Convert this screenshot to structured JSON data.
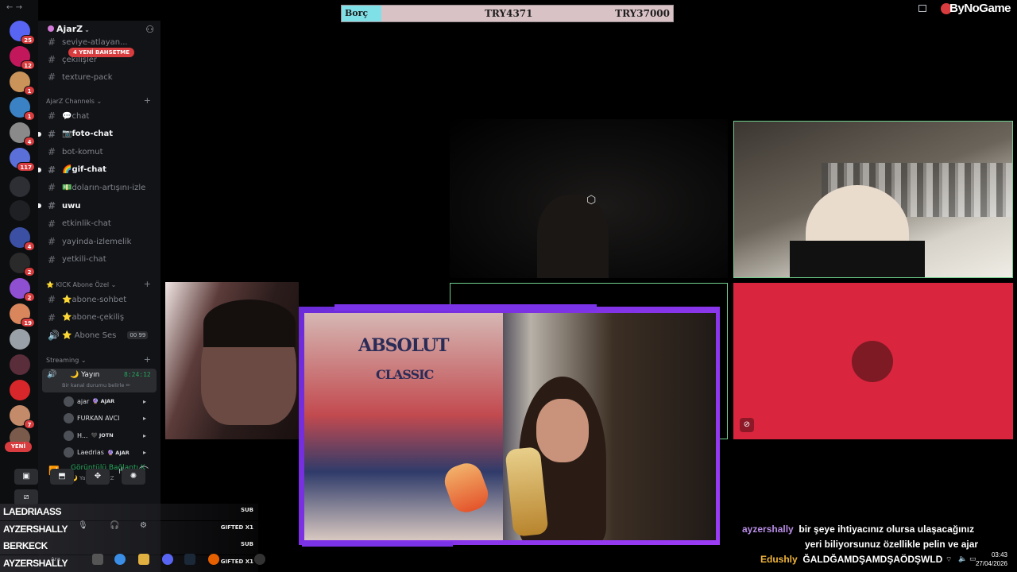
{
  "top_nav": {
    "back": "←",
    "forward": "→"
  },
  "rail": {
    "servers": [
      {
        "badge": "25",
        "color": "#5865f2"
      },
      {
        "badge": "12",
        "color": "#c2185b"
      },
      {
        "badge": "1",
        "color": "#c9935a"
      },
      {
        "badge": "1",
        "color": "#3b82c4"
      },
      {
        "badge": "4",
        "color": "#8a8a8a"
      },
      {
        "badge": "117",
        "color": "#5b6fd8"
      },
      {
        "badge": "",
        "color": "#2d2f35"
      },
      {
        "badge": "",
        "color": "#1f2023"
      },
      {
        "badge": "4",
        "color": "#3b4fa3"
      },
      {
        "badge": "2",
        "color": "#2a2a2a"
      },
      {
        "badge": "2",
        "color": "#8e4fd0"
      },
      {
        "badge": "19",
        "color": "#d9865c"
      },
      {
        "badge": "",
        "color": "#9aa0a8"
      },
      {
        "badge": "",
        "color": "#5a2d3a"
      },
      {
        "badge": "",
        "color": "#d8272a"
      },
      {
        "badge": "7",
        "color": "#c48b6a"
      },
      {
        "badge": "",
        "color": "#7a5a4a"
      }
    ],
    "new_pill": "YENİ"
  },
  "sidebar": {
    "server_name": "AjarZ",
    "mention_pill": "4 YENİ BAHSETME",
    "top_channels": [
      {
        "name": "seviye-atlayan...",
        "bold": false
      },
      {
        "name": "çekilişler",
        "bold": false
      },
      {
        "name": "texture-pack",
        "bold": false
      }
    ],
    "categories": [
      {
        "name": "AjarZ Channels",
        "channels": [
          {
            "name": "💬chat",
            "bold": false,
            "unread": false
          },
          {
            "name": "📷foto-chat",
            "bold": true,
            "unread": true
          },
          {
            "name": "bot-komut",
            "bold": false,
            "unread": false
          },
          {
            "name": "🌈gif-chat",
            "bold": true,
            "unread": true
          },
          {
            "name": "💵doların-artışını-izle",
            "bold": false,
            "unread": false
          },
          {
            "name": "uwu",
            "bold": true,
            "unread": true
          },
          {
            "name": "etkinlik-chat",
            "bold": false,
            "unread": false
          },
          {
            "name": "yayinda-izlemelik",
            "bold": false,
            "unread": false
          },
          {
            "name": "yetkili-chat",
            "bold": false,
            "unread": false
          }
        ]
      },
      {
        "name": "⭐ KICK Abone Özel",
        "channels": [
          {
            "name": "⭐abone-sohbet",
            "bold": false,
            "unread": false
          },
          {
            "name": "⭐abone-çekiliş",
            "bold": false,
            "unread": false
          },
          {
            "name": "⭐ Abone Ses",
            "bold": false,
            "unread": false,
            "counts": "00  99"
          }
        ]
      }
    ],
    "streaming": {
      "category": "Streaming",
      "channel": "🌙 Yayın",
      "elapsed": "8:24:12",
      "status": "Bir kanal durumu belirle ✏",
      "users": [
        {
          "name": "ajar",
          "tag": "🔮 AJAR"
        },
        {
          "name": "FURKAN AVCI",
          "tag": ""
        },
        {
          "name": "H...",
          "tag": "🖤 JOTN"
        },
        {
          "name": "Laedrias",
          "tag": "🔮 AJAR"
        }
      ]
    },
    "connection": {
      "title": "Görüntülü Bağlantı K",
      "subtitle": "🌙 Yayın / AjarZ"
    }
  },
  "subs": [
    {
      "name": "LAEDRIAASS",
      "tag": "SUB"
    },
    {
      "name": "AYZERSHALLY",
      "tag": "GIFTED X1"
    },
    {
      "name": "BERKECK",
      "tag": "SUB"
    },
    {
      "name": "AYZERSHALLY",
      "tag": "GIFTED X1"
    }
  ],
  "debt": {
    "label": "Borç",
    "current": "TRY4371",
    "target": "TRY37000"
  },
  "brand": "ByNoGame",
  "poster": {
    "line1": "ABSOLUT",
    "line2": "CLASSIC"
  },
  "chat": {
    "messages": [
      {
        "user": "ayzershally",
        "text": "bir şeye ihtiyacınız olursa ulaşacağınız"
      },
      {
        "user": "",
        "text": "yeri biliyorsunuz özellikle pelin ve ajar"
      },
      {
        "user": "Edushly",
        "text": "ĞALDĞAMDŞAMDŞAÖDŞWLD"
      }
    ]
  },
  "taskbar": {
    "search": "Ara",
    "time": "03:43",
    "date": "27/04/2026"
  }
}
